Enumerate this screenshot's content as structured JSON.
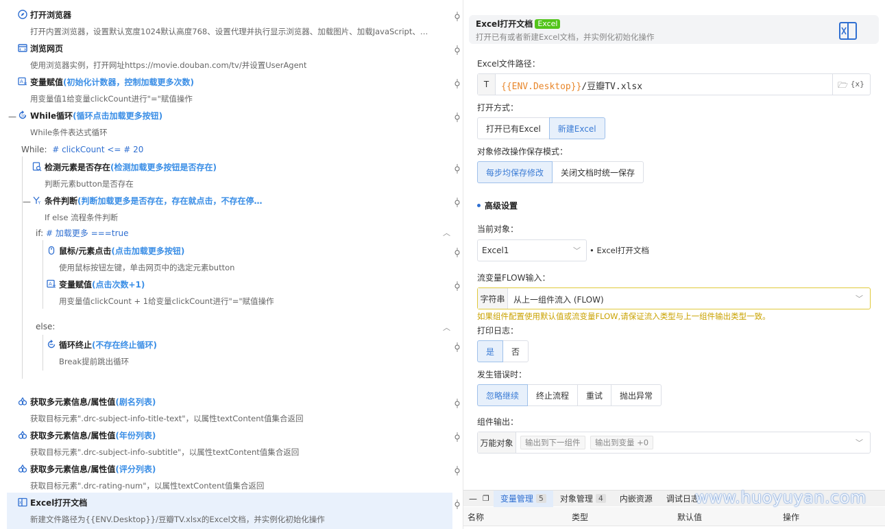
{
  "flow": {
    "steps": [
      {
        "name": "打开浏览器",
        "note": "",
        "desc": "打开内置浏览器，设置默认宽度1024默认高度768、设置代理并执行显示浏览器、加载图片、加载JavaScript、…",
        "icon": "compass-icon"
      },
      {
        "name": "浏览网页",
        "note": "",
        "desc": "使用浏览器实例，打开网址https://movie.douban.com/tv/并设置UserAgent",
        "icon": "browser-window-icon"
      },
      {
        "name": "变量赋值",
        "note": "(初始化计数器，控制加载更多次数)",
        "desc": "用变量值1给变量clickCount进行\"=\"赋值操作",
        "icon": "variable-assign-icon"
      },
      {
        "name": "While循环",
        "note": "(循环点击加载更多按钮)",
        "desc": "While条件表达式循环",
        "icon": "loop-icon"
      },
      {
        "name": "检测元素是否存在",
        "note": "(检测加载更多按钮是否存在)",
        "desc": "判断元素button是否存在",
        "icon": "element-check-icon"
      },
      {
        "name": "条件判断",
        "note": "(判断加载更多是否存在，存在就点击，不存在停…",
        "desc": "If else 流程条件判断",
        "icon": "condition-icon"
      },
      {
        "name": "鼠标/元素点击",
        "note": "(点击加载更多按钮)",
        "desc": "使用鼠标按钮左键，单击网页中的选定元素button",
        "icon": "mouse-icon"
      },
      {
        "name": "变量赋值",
        "note": "(点击次数+1)",
        "desc": "用变量值clickCount + 1给变量clickCount进行\"=\"赋值操作",
        "icon": "variable-assign-icon"
      },
      {
        "name": "循环终止",
        "note": "(不存在终止循环)",
        "desc": "Break提前跳出循环",
        "icon": "loop-break-icon"
      },
      {
        "name": "获取多元素信息/属性值",
        "note": "(剧名列表)",
        "desc": "获取目标元素\".drc-subject-info-title-text\"，以属性textContent值集合返回",
        "icon": "multi-element-icon"
      },
      {
        "name": "获取多元素信息/属性值",
        "note": "(年份列表)",
        "desc": "获取目标元素\".drc-subject-info-subtitle\"，以属性textContent值集合返回",
        "icon": "multi-element-icon"
      },
      {
        "name": "获取多元素信息/属性值",
        "note": "(评分列表)",
        "desc": "获取目标元素\".drc-rating-num\"，以属性textContent值集合返回",
        "icon": "multi-element-icon"
      },
      {
        "name": "Excel打开文档",
        "note": "",
        "desc": "新建文件路径为{{ENV.Desktop}}/豆瓣TV.xlsx的Excel文档，并实例化初始化操作",
        "icon": "excel-icon"
      }
    ],
    "while_kw": "While:",
    "while_expr": "# clickCount <= # 20",
    "if_kw": "if:",
    "if_expr": "# 加载更多 ===true",
    "else_kw": "else:"
  },
  "panel": {
    "title": "Excel打开文档",
    "badge": "Excel",
    "desc": "打开已有或者新建Excel文档，并实例化初始化操作",
    "path_label": "Excel文件路径：",
    "path_type": "T",
    "path_env": "{{ENV.Desktop}}",
    "path_rest": "/豆瓣TV.xlsx",
    "open_label": "打开方式：",
    "open_options": [
      "打开已有Excel",
      "新建Excel"
    ],
    "open_selected": "新建Excel",
    "save_label": "对象修改操作保存模式：",
    "save_options": [
      "每步均保存修改",
      "关闭文档时统一保存"
    ],
    "save_selected": "每步均保存修改",
    "advanced": "高级设置",
    "cur_obj_label": "当前对象：",
    "cur_obj_value": "Excel1",
    "cur_obj_hint": "Excel打开文档",
    "flow_label": "流变量FLOW输入：",
    "flow_type": "字符串",
    "flow_value": "从上一组件流入 (FLOW)",
    "flow_warning": "如果组件配置使用默认值或流变量FLOW,请保证流入类型与上一组件输出类型一致。",
    "log_label": "打印日志：",
    "log_options": [
      "是",
      "否"
    ],
    "log_selected": "是",
    "err_label": "发生错误时：",
    "err_options": [
      "忽略继续",
      "终止流程",
      "重试",
      "抛出异常"
    ],
    "err_selected": "忽略继续",
    "out_label": "组件输出：",
    "out_type": "万能对象",
    "out_next": "输出到下一组件",
    "out_var": "输出到变量 +0",
    "colors": {
      "accent": "#3a7bd5",
      "warning": "#c9a200",
      "excel_green": "#52c41a"
    }
  },
  "bottom": {
    "tabs": [
      {
        "label": "变量管理",
        "count": "5"
      },
      {
        "label": "对象管理",
        "count": "4"
      },
      {
        "label": "内嵌资源",
        "count": ""
      },
      {
        "label": "调试日志",
        "count": ""
      }
    ],
    "columns": [
      "名称",
      "类型",
      "默认值",
      "操作"
    ],
    "watermark": "www.huoyuyan.com"
  }
}
